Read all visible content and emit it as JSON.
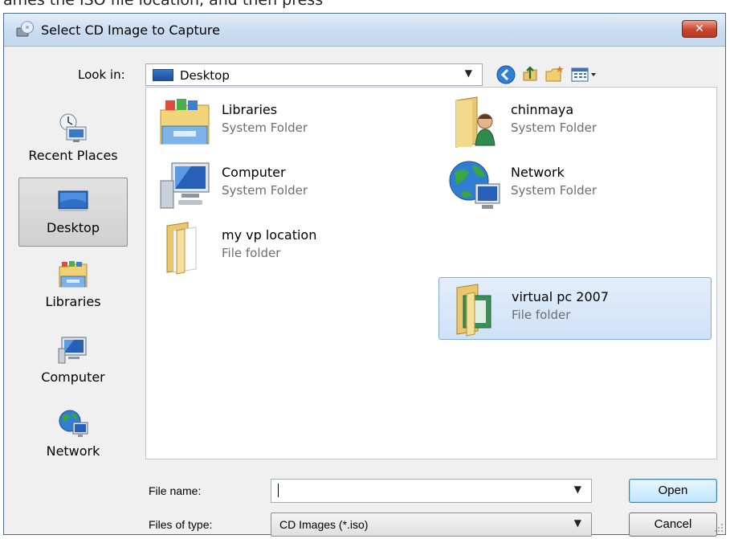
{
  "window": {
    "title": "Select CD Image to Capture",
    "close_label": "✕"
  },
  "toolbar": {
    "look_in_label": "Look in:",
    "look_in_value": "Desktop",
    "buttons": [
      "back-icon",
      "up-folder-icon",
      "new-folder-icon",
      "view-menu-icon"
    ]
  },
  "places": [
    {
      "label": "Recent Places",
      "icon": "recent-places-icon",
      "selected": false
    },
    {
      "label": "Desktop",
      "icon": "desktop-icon",
      "selected": true
    },
    {
      "label": "Libraries",
      "icon": "libraries-icon",
      "selected": false
    },
    {
      "label": "Computer",
      "icon": "computer-icon",
      "selected": false
    },
    {
      "label": "Network",
      "icon": "network-icon",
      "selected": false
    }
  ],
  "files": [
    {
      "name": "Libraries",
      "type": "System Folder",
      "icon": "libraries-folder-icon",
      "selected": false
    },
    {
      "name": "chinmaya",
      "type": "System Folder",
      "icon": "user-folder-icon",
      "selected": false
    },
    {
      "name": "Computer",
      "type": "System Folder",
      "icon": "computer-icon",
      "selected": false
    },
    {
      "name": "Network",
      "type": "System Folder",
      "icon": "network-icon",
      "selected": false
    },
    {
      "name": "my vp location",
      "type": "File folder",
      "icon": "folder-icon",
      "selected": false
    },
    {
      "name": "virtual pc 2007",
      "type": "File folder",
      "icon": "folder-icon",
      "selected": true
    }
  ],
  "footer": {
    "file_name_label": "File name:",
    "file_name_value": "",
    "files_of_type_label": "Files of type:",
    "files_of_type_value": "CD Images (*.iso)",
    "open_label": "Open",
    "cancel_label": "Cancel"
  },
  "colors": {
    "title_gradient": "#cadcf0",
    "selection": "#cfe1f7",
    "close": "#c9452c"
  }
}
